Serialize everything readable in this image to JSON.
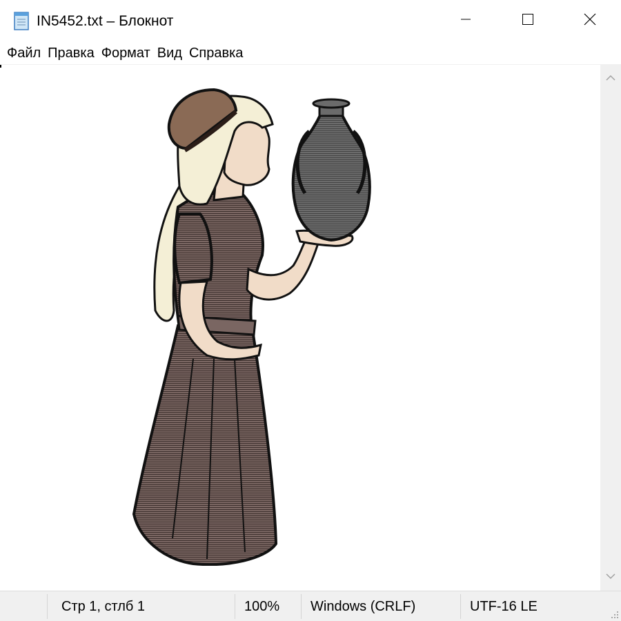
{
  "window": {
    "title": "IN5452.txt – Блокнот",
    "icon": "notepad-icon"
  },
  "controls": {
    "minimize_icon": "minimize-icon",
    "maximize_icon": "maximize-icon",
    "close_icon": "close-icon"
  },
  "menu": {
    "items": [
      {
        "label": "Файл"
      },
      {
        "label": "Правка"
      },
      {
        "label": "Формат"
      },
      {
        "label": "Вид"
      },
      {
        "label": "Справка"
      }
    ]
  },
  "editor": {
    "content_image": "woman-holding-vase-illustration"
  },
  "statusbar": {
    "position": "Стр 1, стлб 1",
    "zoom": "100%",
    "line_endings": "Windows (CRLF)",
    "encoding": "UTF-16 LE"
  },
  "colors": {
    "dress": "#7a6662",
    "hat": "#8a6a55",
    "headscarf": "#f4efd6",
    "skin": "#f1dcc8",
    "vase": "#666666",
    "outline": "#1a1a1a"
  }
}
